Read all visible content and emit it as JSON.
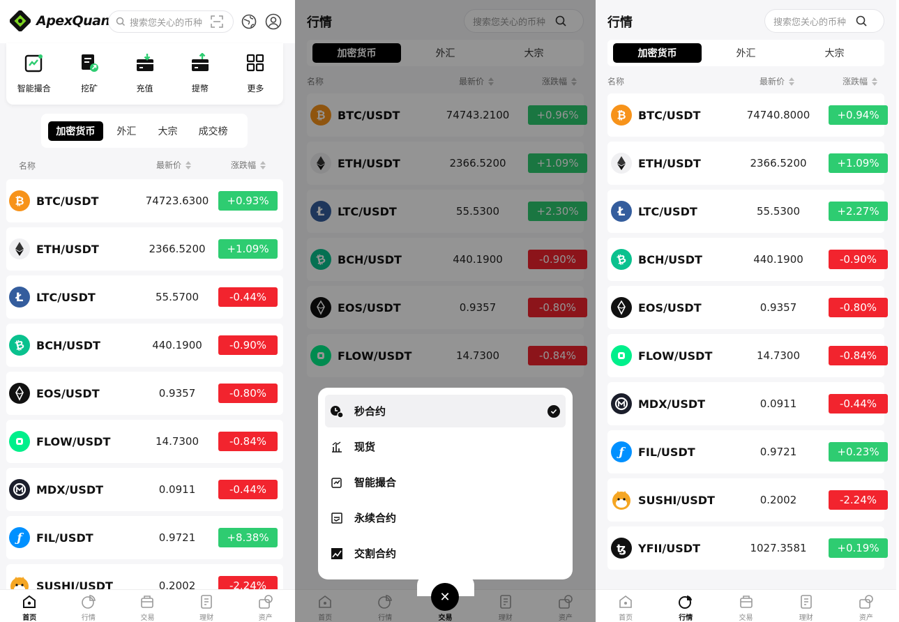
{
  "home": {
    "brand": "ApexQuant",
    "search_placeholder": "搜索您关心的币种",
    "quick": [
      "智能撮合",
      "挖矿",
      "充值",
      "提幣",
      "更多"
    ],
    "tabs": [
      "加密货币",
      "外汇",
      "大宗",
      "成交榜"
    ],
    "col_name": "名称",
    "col_price": "最新价",
    "col_change": "涨跌幅",
    "rows": [
      {
        "pair": "BTC/USDT",
        "price": "74723.6300",
        "change": "+0.93%",
        "dir": "up",
        "icon": "bitcoin-icon"
      },
      {
        "pair": "ETH/USDT",
        "price": "2366.5200",
        "change": "+1.09%",
        "dir": "up",
        "icon": "ethereum-icon"
      },
      {
        "pair": "LTC/USDT",
        "price": "55.5700",
        "change": "-0.44%",
        "dir": "dn",
        "icon": "litecoin-icon"
      },
      {
        "pair": "BCH/USDT",
        "price": "440.1900",
        "change": "-0.90%",
        "dir": "dn",
        "icon": "bitcoin-cash-icon"
      },
      {
        "pair": "EOS/USDT",
        "price": "0.9357",
        "change": "-0.80%",
        "dir": "dn",
        "icon": "eos-icon"
      },
      {
        "pair": "FLOW/USDT",
        "price": "14.7300",
        "change": "-0.84%",
        "dir": "dn",
        "icon": "flow-icon"
      },
      {
        "pair": "MDX/USDT",
        "price": "0.0911",
        "change": "-0.44%",
        "dir": "dn",
        "icon": "mdex-icon"
      },
      {
        "pair": "FIL/USDT",
        "price": "0.9721",
        "change": "+8.38%",
        "dir": "up",
        "icon": "filecoin-icon"
      },
      {
        "pair": "SUSHI/USDT",
        "price": "0.2002",
        "change": "-2.24%",
        "dir": "dn",
        "icon": "sushi-icon"
      }
    ]
  },
  "market": {
    "title": "行情",
    "search_placeholder": "搜索您关心的币种",
    "tabs": [
      "加密货币",
      "外汇",
      "大宗"
    ],
    "col_name": "名称",
    "col_price": "最新价",
    "col_change": "涨跌幅"
  },
  "market_mid": {
    "rows": [
      {
        "pair": "BTC/USDT",
        "price": "74743.2100",
        "change": "+0.96%",
        "dir": "up",
        "icon": "bitcoin-icon"
      },
      {
        "pair": "ETH/USDT",
        "price": "2366.5200",
        "change": "+1.09%",
        "dir": "up",
        "icon": "ethereum-icon"
      },
      {
        "pair": "LTC/USDT",
        "price": "55.5300",
        "change": "+2.30%",
        "dir": "up",
        "icon": "litecoin-icon"
      },
      {
        "pair": "BCH/USDT",
        "price": "440.1900",
        "change": "-0.90%",
        "dir": "dn",
        "icon": "bitcoin-cash-icon"
      },
      {
        "pair": "EOS/USDT",
        "price": "0.9357",
        "change": "-0.80%",
        "dir": "dn",
        "icon": "eos-icon"
      },
      {
        "pair": "FLOW/USDT",
        "price": "14.7300",
        "change": "-0.84%",
        "dir": "dn",
        "icon": "flow-icon"
      }
    ]
  },
  "market_right": {
    "rows": [
      {
        "pair": "BTC/USDT",
        "price": "74740.8000",
        "change": "+0.94%",
        "dir": "up",
        "icon": "bitcoin-icon"
      },
      {
        "pair": "ETH/USDT",
        "price": "2366.5200",
        "change": "+1.09%",
        "dir": "up",
        "icon": "ethereum-icon"
      },
      {
        "pair": "LTC/USDT",
        "price": "55.5300",
        "change": "+2.27%",
        "dir": "up",
        "icon": "litecoin-icon"
      },
      {
        "pair": "BCH/USDT",
        "price": "440.1900",
        "change": "-0.90%",
        "dir": "dn",
        "icon": "bitcoin-cash-icon"
      },
      {
        "pair": "EOS/USDT",
        "price": "0.9357",
        "change": "-0.80%",
        "dir": "dn",
        "icon": "eos-icon"
      },
      {
        "pair": "FLOW/USDT",
        "price": "14.7300",
        "change": "-0.84%",
        "dir": "dn",
        "icon": "flow-icon"
      },
      {
        "pair": "MDX/USDT",
        "price": "0.0911",
        "change": "-0.44%",
        "dir": "dn",
        "icon": "mdex-icon"
      },
      {
        "pair": "FIL/USDT",
        "price": "0.9721",
        "change": "+0.23%",
        "dir": "up",
        "icon": "filecoin-icon"
      },
      {
        "pair": "SUSHI/USDT",
        "price": "0.2002",
        "change": "-2.24%",
        "dir": "dn",
        "icon": "sushi-icon"
      },
      {
        "pair": "YFII/USDT",
        "price": "1027.3581",
        "change": "+0.19%",
        "dir": "up",
        "icon": "yfii-icon"
      }
    ]
  },
  "trade_menu": {
    "items": [
      "秒合约",
      "现货",
      "智能撮合",
      "永续合约",
      "交割合约"
    ],
    "selected": "秒合约"
  },
  "nav": [
    "首页",
    "行情",
    "交易",
    "理财",
    "资产"
  ],
  "colors": {
    "up": "#2ecc71",
    "down": "#f2242e",
    "brand_green": "#7dd321",
    "coin_btc": "#f7931a",
    "coin_ltc": "#345d9d",
    "coin_bch": "#0ac18e",
    "coin_fil": "#0090ff",
    "coin_flow": "#00ef8b"
  }
}
